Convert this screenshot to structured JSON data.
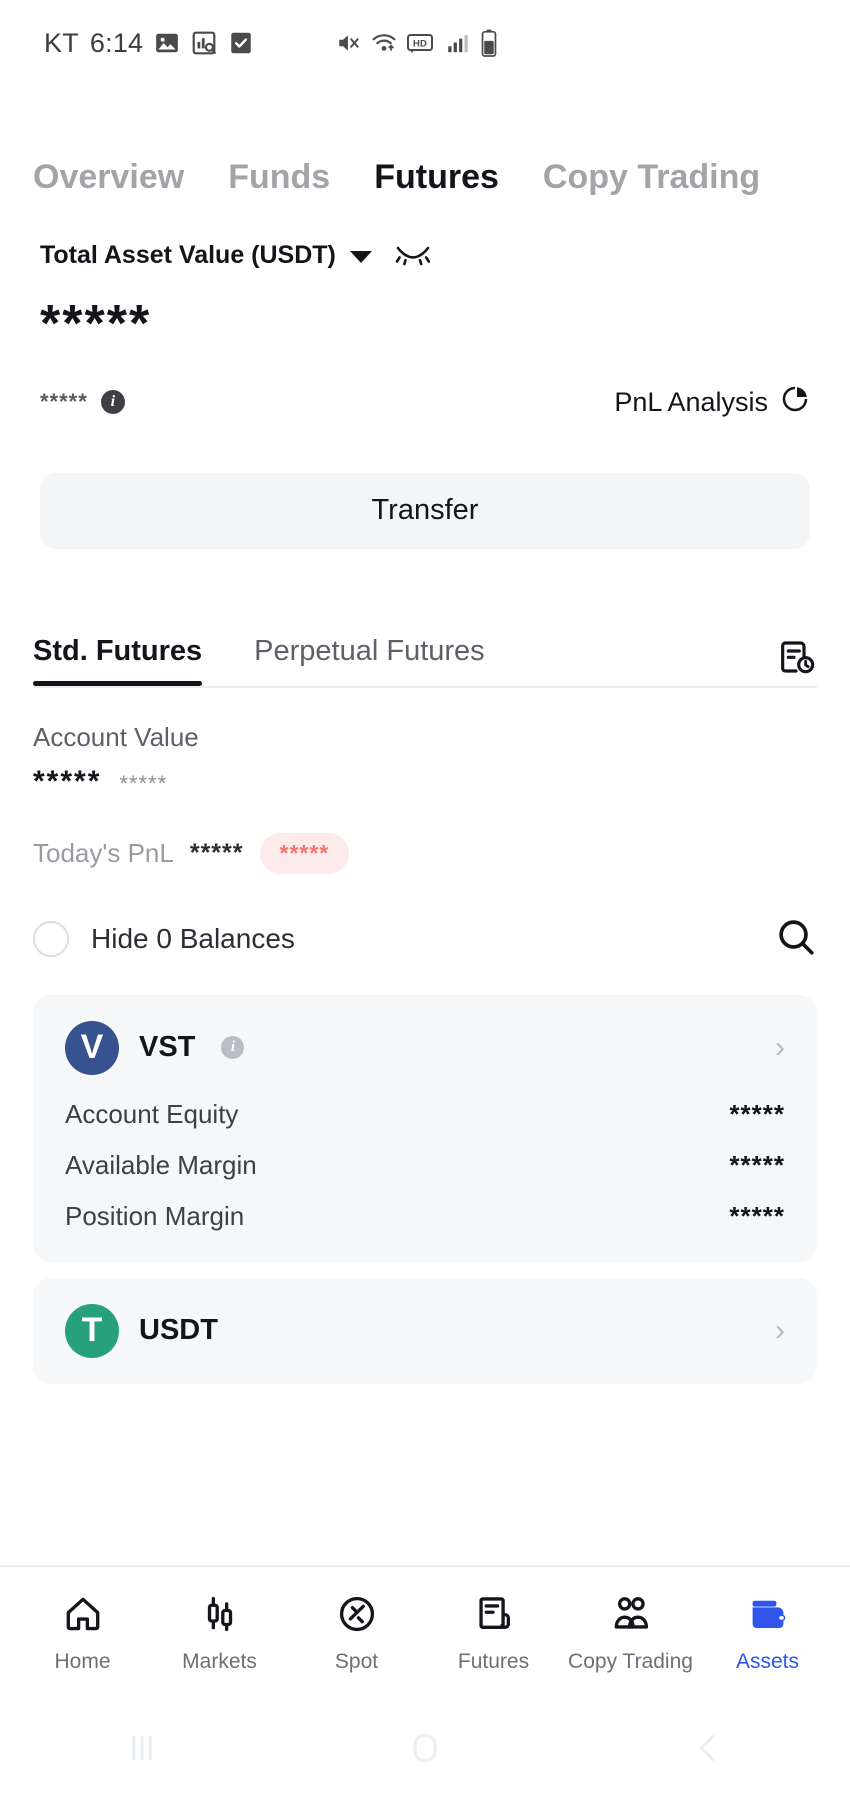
{
  "status_bar": {
    "carrier": "KT",
    "time": "6:14",
    "left_icons": [
      "image-icon",
      "chart-search-icon",
      "checkbox-checked-icon"
    ],
    "right_icons": [
      "mute-vibrate-icon",
      "wifi-icon",
      "hd-icon",
      "signal-icon",
      "battery-icon"
    ]
  },
  "top_tabs": [
    {
      "label": "Overview",
      "active": false
    },
    {
      "label": "Funds",
      "active": false
    },
    {
      "label": "Futures",
      "active": true
    },
    {
      "label": "Copy Trading",
      "active": false
    }
  ],
  "asset_header": {
    "label": "Total Asset Value (USDT)",
    "dropdown_icon": "chevron-down-icon",
    "visibility_icon": "eye-off-icon",
    "value_masked": "*****",
    "sub_value_masked": "*****",
    "info_icon": "info-icon",
    "pnl_analysis_label": "PnL Analysis",
    "pnl_analysis_icon": "pie-chart-icon"
  },
  "transfer": {
    "label": "Transfer"
  },
  "sub_tabs": [
    {
      "label": "Std. Futures",
      "active": true
    },
    {
      "label": "Perpetual Futures",
      "active": false
    }
  ],
  "history_icon": "order-history-icon",
  "account": {
    "label": "Account Value",
    "value_masked": "*****",
    "value_sub_masked": "*****",
    "pnl_label": "Today's PnL",
    "pnl_value_masked": "*****",
    "pnl_percent_masked": "*****",
    "pnl_badge_color": "#fdeaea",
    "pnl_badge_text_color": "#f0776f"
  },
  "filters": {
    "hide_zero_label": "Hide 0 Balances",
    "hide_zero_checked": false,
    "search_icon": "search-icon"
  },
  "coins": [
    {
      "symbol": "VST",
      "logo_letter": "V",
      "logo_color": "#36538f",
      "has_info": true,
      "chevron": "›",
      "rows": [
        {
          "label": "Account Equity",
          "value": "*****"
        },
        {
          "label": "Available Margin",
          "value": "*****"
        },
        {
          "label": "Position Margin",
          "value": "*****"
        }
      ]
    },
    {
      "symbol": "USDT",
      "logo_letter": "T",
      "logo_color": "#26a17b",
      "has_info": false,
      "chevron": "›",
      "rows": []
    }
  ],
  "bottom_nav": [
    {
      "label": "Home",
      "icon": "home-icon",
      "active": false
    },
    {
      "label": "Markets",
      "icon": "candlestick-icon",
      "active": false
    },
    {
      "label": "Spot",
      "icon": "spot-trade-icon",
      "active": false
    },
    {
      "label": "Futures",
      "icon": "contract-icon",
      "active": false
    },
    {
      "label": "Copy Trading",
      "icon": "people-icon",
      "active": false
    },
    {
      "label": "Assets",
      "icon": "wallet-icon",
      "active": true
    }
  ],
  "nav_active_color": "#2f55ec",
  "system_nav": [
    "recents-icon",
    "home-circle-icon",
    "back-icon"
  ]
}
